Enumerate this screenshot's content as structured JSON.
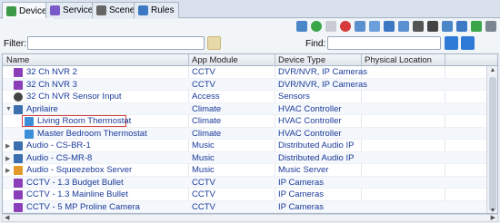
{
  "tabs": [
    {
      "label": "Devices",
      "icon": "devices-icon"
    },
    {
      "label": "Services",
      "icon": "services-icon"
    },
    {
      "label": "Scenes",
      "icon": "scenes-icon"
    },
    {
      "label": "Rules",
      "icon": "rules-icon"
    }
  ],
  "filter": {
    "label": "Filter:",
    "value": ""
  },
  "find": {
    "label": "Find:",
    "value": ""
  },
  "columns": [
    "Name",
    "App Module",
    "Device Type",
    "Physical Location"
  ],
  "rows": [
    {
      "name": "32 Ch NVR 2",
      "app": "CCTV",
      "type": "DVR/NVR, IP Cameras",
      "icon": "camera-icon"
    },
    {
      "name": "32 Ch NVR 3",
      "app": "CCTV",
      "type": "DVR/NVR, IP Cameras",
      "icon": "camera-icon"
    },
    {
      "name": "32 Ch NVR Sensor Input",
      "app": "Access",
      "type": "Sensors",
      "icon": "sensor-icon"
    },
    {
      "name": "Aprilaire",
      "app": "Climate",
      "type": "HVAC Controller",
      "icon": "house-icon"
    },
    {
      "name": "Living Room Thermostat",
      "app": "Climate",
      "type": "HVAC Controller",
      "icon": "thermostat-icon"
    },
    {
      "name": "Master Bedroom Thermostat",
      "app": "Climate",
      "type": "HVAC Controller",
      "icon": "thermostat-icon"
    },
    {
      "name": "Audio - CS-BR-1",
      "app": "Music",
      "type": "Distributed Audio IP",
      "icon": "house-icon"
    },
    {
      "name": "Audio - CS-MR-8",
      "app": "Music",
      "type": "Distributed Audio IP",
      "icon": "house-icon"
    },
    {
      "name": "Audio - Squeezebox Server",
      "app": "Music",
      "type": "Music Server",
      "icon": "music-icon"
    },
    {
      "name": "CCTV - 1.3 Budget Bullet",
      "app": "CCTV",
      "type": "IP Cameras",
      "icon": "camera-icon"
    },
    {
      "name": "CCTV - 1.3 Mainline Bullet",
      "app": "CCTV",
      "type": "IP Cameras",
      "icon": "camera-icon"
    },
    {
      "name": "CCTV - 5 MP Proline Camera",
      "app": "CCTV",
      "type": "IP Cameras",
      "icon": "camera-icon"
    }
  ],
  "colors": {
    "accent": "#1a3b9a",
    "camera": "#8a3fb8",
    "house": "#3b6fb0",
    "thermostat": "#3b8ed8",
    "music": "#e39a2a",
    "sensor": "#444444",
    "selection": "#d94040"
  }
}
